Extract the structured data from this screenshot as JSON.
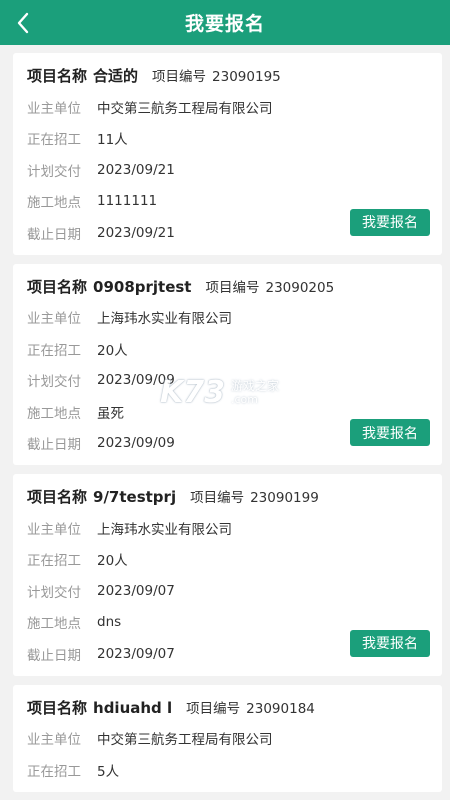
{
  "header": {
    "title": "我要报名",
    "back_icon": "chevron-left-icon",
    "color": "#1b9f7b"
  },
  "labels": {
    "project_name": "项目名称",
    "project_code": "项目编号",
    "owner": "业主单位",
    "recruiting": "正在招工",
    "delivery": "计划交付",
    "location": "施工地点",
    "deadline": "截止日期",
    "signup_button": "我要报名"
  },
  "projects": [
    {
      "name": "合适的",
      "code": "23090195",
      "owner": "中交第三航务工程局有限公司",
      "recruiting": "11人",
      "delivery": "2023/09/21",
      "location": "1111111",
      "deadline": "2023/09/21"
    },
    {
      "name": "0908prjtest",
      "code": "23090205",
      "owner": "上海玮水实业有限公司",
      "recruiting": "20人",
      "delivery": "2023/09/09",
      "location": "虽死",
      "deadline": "2023/09/09"
    },
    {
      "name": "9/7testprj",
      "code": "23090199",
      "owner": "上海玮水实业有限公司",
      "recruiting": "20人",
      "delivery": "2023/09/07",
      "location": "dns",
      "deadline": "2023/09/07"
    },
    {
      "name": "hdiuahd l",
      "code": "23090184",
      "owner": "中交第三航务工程局有限公司",
      "recruiting": "5人",
      "delivery": "",
      "location": "",
      "deadline": ""
    }
  ],
  "watermark": {
    "logo": "K73",
    "cn": "游戏之家",
    "url": ".com"
  }
}
